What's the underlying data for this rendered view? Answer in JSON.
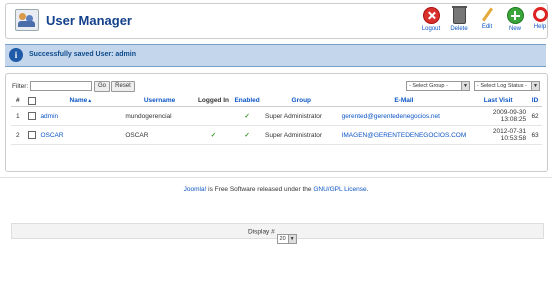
{
  "header": {
    "title": "User Manager"
  },
  "toolbar": {
    "logout": "Logout",
    "delete": "Delete",
    "edit": "Edit",
    "new": "New",
    "help": "Help"
  },
  "message": {
    "text": "Successfully saved User: admin"
  },
  "filter": {
    "label": "Filter:",
    "value": "",
    "placeholder": "",
    "go": "Go",
    "reset": "Reset",
    "group_select": "- Select Group -",
    "status_select": "- Select Log Status -"
  },
  "table": {
    "columns": [
      "#",
      "",
      "Name",
      "Username",
      "Logged In",
      "Enabled",
      "Group",
      "E-Mail",
      "Last Visit",
      "ID"
    ],
    "rows": [
      {
        "num": "1",
        "name": "admin",
        "username": "mundogerencial",
        "logged_in": "",
        "enabled": "✓",
        "group": "Super Administrator",
        "email": "gerented@gerentedenegocios.net",
        "last_visit": "2009-09-30 13:08:25",
        "id": "62"
      },
      {
        "num": "2",
        "name": "OSCAR",
        "username": "OSCAR",
        "logged_in": "✓",
        "enabled": "✓",
        "group": "Super Administrator",
        "email": "IMAGEN@GERENTEDENEGOCIOS.COM",
        "last_visit": "2012-07-31 10:53:58",
        "id": "63"
      }
    ]
  },
  "pagination": {
    "label": "Display #",
    "value": "20"
  },
  "footer": {
    "joomla": "Joomla!",
    "mid": " is Free Software released under the ",
    "license": "GNU/GPL License",
    "end": "."
  },
  "colors": {
    "accent": "#14418b",
    "link": "#0b55c4",
    "message_bg": "#c3d6ec"
  }
}
